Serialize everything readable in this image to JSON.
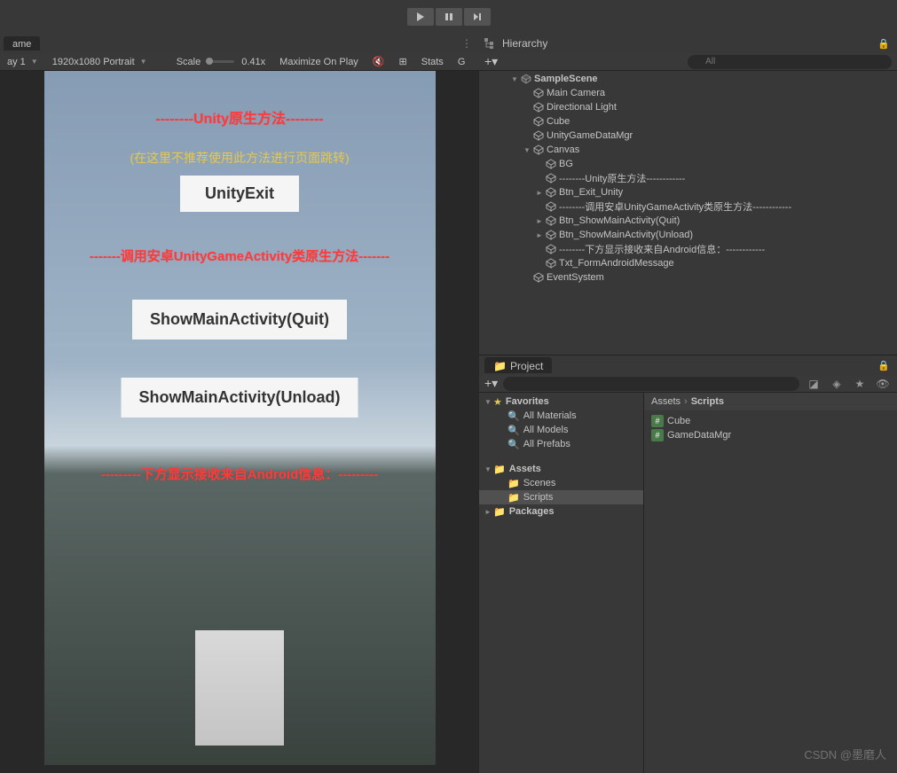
{
  "toolbar": {
    "play": "play",
    "pause": "pause",
    "step": "step"
  },
  "game": {
    "tab_label": "ame",
    "display_label": "ay 1",
    "resolution": "1920x1080 Portrait",
    "scale_label": "Scale",
    "scale_value": "0.41x",
    "maximize": "Maximize On Play",
    "stats": "Stats",
    "gizmos": "G"
  },
  "scene_ui": {
    "header1": "--------Unity原生方法--------",
    "note": "(在这里不推荐使用此方法进行页面跳转)",
    "btn_exit": "UnityExit",
    "header2": "-------调用安卓UnityGameActivity类原生方法-------",
    "btn_quit": "ShowMainActivity(Quit)",
    "btn_unload": "ShowMainActivity(Unload)",
    "header3": "---------下方显示接收来自Android信息：---------"
  },
  "hierarchy": {
    "title": "Hierarchy",
    "search_placeholder": "All",
    "scene": "SampleScene",
    "nodes": [
      {
        "name": "Main Camera",
        "indent": 2
      },
      {
        "name": "Directional Light",
        "indent": 2
      },
      {
        "name": "Cube",
        "indent": 2
      },
      {
        "name": "UnityGameDataMgr",
        "indent": 2
      },
      {
        "name": "Canvas",
        "indent": 2,
        "arrow": "▼"
      },
      {
        "name": "BG",
        "indent": 3
      },
      {
        "name": "--------Unity原生方法------------",
        "indent": 3
      },
      {
        "name": "Btn_Exit_Unity",
        "indent": 3,
        "arrow": "►"
      },
      {
        "name": "--------调用安卓UnityGameActivity类原生方法------------",
        "indent": 3
      },
      {
        "name": "Btn_ShowMainActivity(Quit)",
        "indent": 3,
        "arrow": "►"
      },
      {
        "name": "Btn_ShowMainActivity(Unload)",
        "indent": 3,
        "arrow": "►"
      },
      {
        "name": "--------下方显示接收来自Android信息：------------",
        "indent": 3
      },
      {
        "name": "Txt_FormAndroidMessage",
        "indent": 3
      },
      {
        "name": "EventSystem",
        "indent": 2
      }
    ]
  },
  "project": {
    "title": "Project",
    "favorites": "Favorites",
    "fav_items": [
      "All Materials",
      "All Models",
      "All Prefabs"
    ],
    "assets": "Assets",
    "asset_folders": [
      "Scenes",
      "Scripts"
    ],
    "packages": "Packages",
    "breadcrumb": [
      "Assets",
      "Scripts"
    ],
    "files": [
      "Cube",
      "GameDataMgr"
    ]
  },
  "watermark": "CSDN @墨磨人"
}
